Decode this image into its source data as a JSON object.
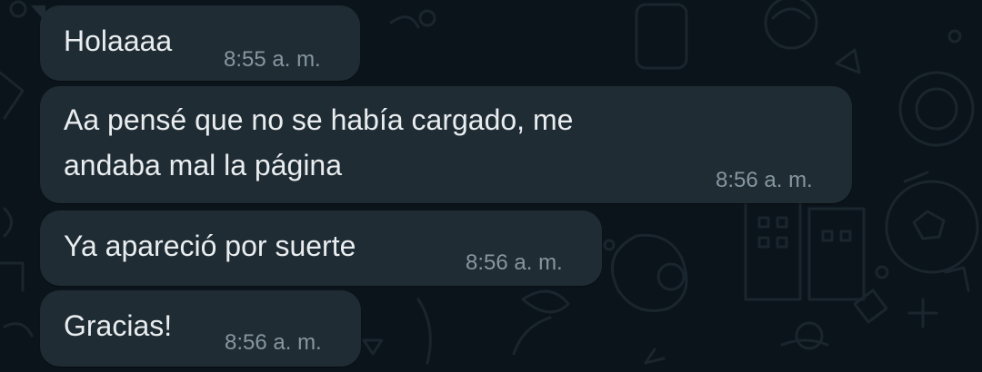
{
  "colors": {
    "background": "#0b141a",
    "bubble": "#1f2c34",
    "text": "#e9edef",
    "timestamp": "#8696a0"
  },
  "messages": [
    {
      "text": "Holaaaa",
      "time": "8:55 a. m."
    },
    {
      "lines": [
        "Aa pensé que no se había cargado, me",
        "andaba mal la página"
      ],
      "time": "8:56 a. m."
    },
    {
      "text": "Ya apareció por suerte",
      "time": "8:56 a. m."
    },
    {
      "text": "Gracias!",
      "time": "8:56 a. m."
    }
  ]
}
